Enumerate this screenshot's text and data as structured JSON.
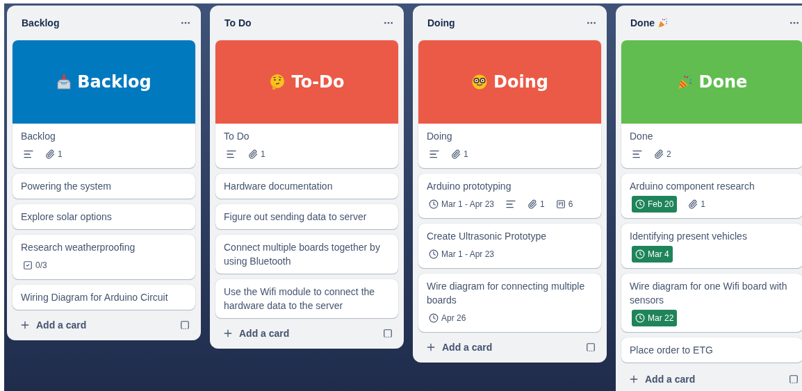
{
  "lists": [
    {
      "title": "Backlog",
      "title_decorated": false,
      "scrollable": false,
      "cover": {
        "title": "Backlog",
        "color": "#0079bf"
      },
      "cards": [
        {
          "title": "Backlog",
          "badges": [
            {
              "kind": "description"
            },
            {
              "kind": "attachment",
              "text": "1"
            }
          ]
        },
        {
          "title": "Powering the system"
        },
        {
          "title": "Explore solar options"
        },
        {
          "title": "Research weatherproofing",
          "badges": [
            {
              "kind": "checklist",
              "text": "0/3"
            }
          ]
        },
        {
          "title": "Wiring Diagram for Arduino Circuit"
        }
      ],
      "add_label": "Add a card"
    },
    {
      "title": "To Do",
      "title_decorated": false,
      "scrollable": false,
      "cover": {
        "title": "To-Do",
        "color": "#eb5a46"
      },
      "cards": [
        {
          "title": "To Do",
          "badges": [
            {
              "kind": "description"
            },
            {
              "kind": "attachment",
              "text": "1"
            }
          ]
        },
        {
          "title": "Hardware documentation"
        },
        {
          "title": "Figure out sending data to server"
        },
        {
          "title": "Connect multiple boards together by using Bluetooth"
        },
        {
          "title": "Use the Wifi module to connect the hardware data to the server"
        }
      ],
      "add_label": "Add a card"
    },
    {
      "title": "Doing",
      "title_decorated": false,
      "scrollable": false,
      "cover": {
        "title": "Doing",
        "color": "#eb5a46"
      },
      "cards": [
        {
          "title": "Doing",
          "badges": [
            {
              "kind": "description"
            },
            {
              "kind": "attachment",
              "text": "1"
            }
          ]
        },
        {
          "title": "Arduino prototyping",
          "badges": [
            {
              "kind": "date",
              "text": "Mar 1 - Apr 23",
              "complete": false
            },
            {
              "kind": "description"
            },
            {
              "kind": "attachment",
              "text": "1"
            },
            {
              "kind": "board",
              "text": "6"
            }
          ]
        },
        {
          "title": "Create Ultrasonic Prototype",
          "badges": [
            {
              "kind": "date",
              "text": "Mar 1 - Apr 23",
              "complete": false
            }
          ]
        },
        {
          "title": "Wire diagram for connecting multiple boards",
          "badges": [
            {
              "kind": "date",
              "text": "Apr 26",
              "complete": false
            }
          ]
        }
      ],
      "add_label": "Add a card"
    },
    {
      "title": "Done",
      "title_decorated": true,
      "scrollable": true,
      "cover": {
        "title": "Done",
        "color": "#61bd4f"
      },
      "cards": [
        {
          "title": "Done",
          "badges": [
            {
              "kind": "description"
            },
            {
              "kind": "attachment",
              "text": "2"
            }
          ]
        },
        {
          "title": "Arduino component research",
          "badges": [
            {
              "kind": "date",
              "text": "Feb 20",
              "complete": true
            },
            {
              "kind": "attachment",
              "text": "1"
            }
          ]
        },
        {
          "title": "Identifying present vehicles",
          "badges": [
            {
              "kind": "date",
              "text": "Mar 4",
              "complete": true
            }
          ]
        },
        {
          "title": "Wire diagram for one Wifi board with sensors",
          "badges": [
            {
              "kind": "date",
              "text": "Mar 22",
              "complete": true
            }
          ]
        },
        {
          "title": "Place order to ETG"
        }
      ],
      "add_label": "Add a card"
    }
  ]
}
